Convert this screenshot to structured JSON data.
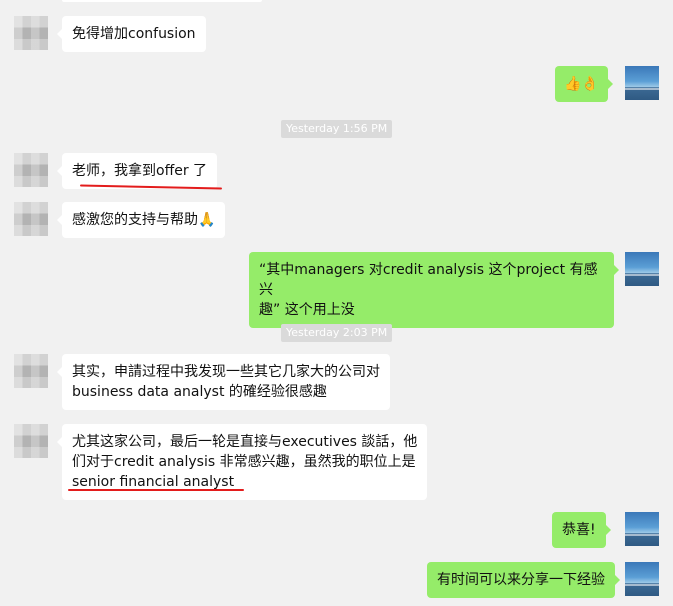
{
  "messages": [
    {
      "side": "left",
      "text": "免得增加confusion"
    },
    {
      "side": "right",
      "text": "👍👌"
    },
    {
      "type": "timestamp",
      "text": "Yesterday 1:56 PM"
    },
    {
      "side": "left",
      "text": "老师，我拿到offer 了"
    },
    {
      "side": "left",
      "text": "感激您的支持与帮助🙏"
    },
    {
      "side": "right",
      "line1": "“其中managers 对credit analysis 这个project 有感兴",
      "line2": "趣” 这个用上没"
    },
    {
      "type": "timestamp",
      "text": "Yesterday 2:03 PM"
    },
    {
      "side": "left",
      "line1": "其实，申請过程中我发现一些其它几家大的公司对",
      "line2": "business data analyst 的確经验很感趣"
    },
    {
      "side": "left",
      "line1": "尤其这家公司，最后一轮是直接与executives 談話，他",
      "line2": "们对于credit analysis 非常感兴趣，虽然我的职位上是",
      "line3": "senior financial analyst"
    },
    {
      "side": "right",
      "text": "恭喜!"
    },
    {
      "side": "right",
      "text": "有时间可以来分享一下经验"
    }
  ],
  "colors": {
    "background": "#f1f1f1",
    "incoming_bubble": "#ffffff",
    "outgoing_bubble": "#95ec69",
    "timestamp_bg": "#dadada",
    "annotation_underline": "#e31c1c"
  }
}
